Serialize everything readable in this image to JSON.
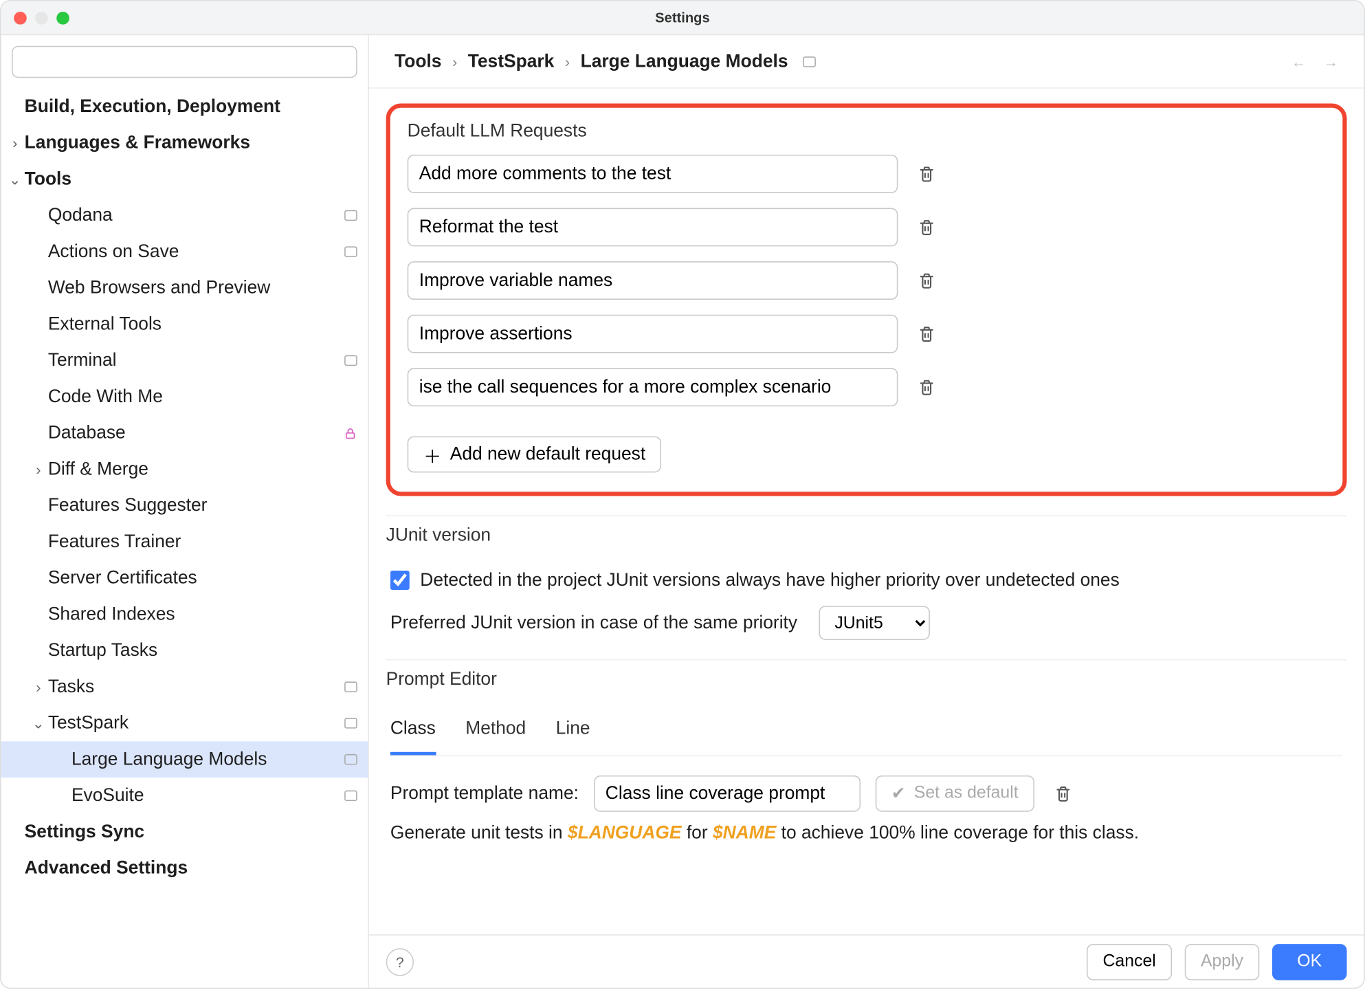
{
  "window": {
    "title": "Settings"
  },
  "search": {
    "placeholder": ""
  },
  "tree": {
    "items": [
      {
        "label": "Build, Execution, Deployment",
        "indent": 1,
        "bold": true,
        "chevron": "none",
        "badge": false,
        "lock": false
      },
      {
        "label": "Languages & Frameworks",
        "indent": 1,
        "bold": true,
        "chevron": "right",
        "badge": false,
        "lock": false
      },
      {
        "label": "Tools",
        "indent": 1,
        "bold": true,
        "chevron": "down",
        "badge": false,
        "lock": false
      },
      {
        "label": "Qodana",
        "indent": 2,
        "bold": false,
        "chevron": "none",
        "badge": true,
        "lock": false
      },
      {
        "label": "Actions on Save",
        "indent": 2,
        "bold": false,
        "chevron": "none",
        "badge": true,
        "lock": false
      },
      {
        "label": "Web Browsers and Preview",
        "indent": 2,
        "bold": false,
        "chevron": "none",
        "badge": false,
        "lock": false
      },
      {
        "label": "External Tools",
        "indent": 2,
        "bold": false,
        "chevron": "none",
        "badge": false,
        "lock": false
      },
      {
        "label": "Terminal",
        "indent": 2,
        "bold": false,
        "chevron": "none",
        "badge": true,
        "lock": false
      },
      {
        "label": "Code With Me",
        "indent": 2,
        "bold": false,
        "chevron": "none",
        "badge": false,
        "lock": false
      },
      {
        "label": "Database",
        "indent": 2,
        "bold": false,
        "chevron": "none",
        "badge": false,
        "lock": true
      },
      {
        "label": "Diff & Merge",
        "indent": 2,
        "bold": false,
        "chevron": "right",
        "badge": false,
        "lock": false
      },
      {
        "label": "Features Suggester",
        "indent": 2,
        "bold": false,
        "chevron": "none",
        "badge": false,
        "lock": false
      },
      {
        "label": "Features Trainer",
        "indent": 2,
        "bold": false,
        "chevron": "none",
        "badge": false,
        "lock": false
      },
      {
        "label": "Server Certificates",
        "indent": 2,
        "bold": false,
        "chevron": "none",
        "badge": false,
        "lock": false
      },
      {
        "label": "Shared Indexes",
        "indent": 2,
        "bold": false,
        "chevron": "none",
        "badge": false,
        "lock": false
      },
      {
        "label": "Startup Tasks",
        "indent": 2,
        "bold": false,
        "chevron": "none",
        "badge": false,
        "lock": false
      },
      {
        "label": "Tasks",
        "indent": 2,
        "bold": false,
        "chevron": "right",
        "badge": true,
        "lock": false
      },
      {
        "label": "TestSpark",
        "indent": 2,
        "bold": false,
        "chevron": "down",
        "badge": true,
        "lock": false
      },
      {
        "label": "Large Language Models",
        "indent": 3,
        "bold": false,
        "chevron": "none",
        "badge": true,
        "lock": false,
        "selected": true
      },
      {
        "label": "EvoSuite",
        "indent": 3,
        "bold": false,
        "chevron": "none",
        "badge": true,
        "lock": false
      },
      {
        "label": "Settings Sync",
        "indent": 1,
        "bold": true,
        "chevron": "none",
        "badge": false,
        "lock": false
      },
      {
        "label": "Advanced Settings",
        "indent": 1,
        "bold": true,
        "chevron": "none",
        "badge": false,
        "lock": false
      }
    ]
  },
  "breadcrumb": {
    "parts": [
      "Tools",
      "TestSpark",
      "Large Language Models"
    ]
  },
  "defaultRequests": {
    "title": "Default LLM Requests",
    "items": [
      "Add more comments to the test",
      "Reformat the test",
      "Improve variable names",
      "Improve assertions",
      "ise the call sequences for a more complex scenario"
    ],
    "addLabel": "Add new default request"
  },
  "junit": {
    "heading": "JUnit version",
    "checkboxLabel": "Detected in the project JUnit versions always have higher priority over undetected ones",
    "checked": true,
    "preferredLabel": "Preferred JUnit version in case of the same priority",
    "preferredValue": "JUnit5"
  },
  "promptEditor": {
    "heading": "Prompt Editor",
    "tabs": [
      "Class",
      "Method",
      "Line"
    ],
    "activeTab": 0,
    "templateNameLabel": "Prompt template name:",
    "templateNameValue": "Class line coverage prompt",
    "setDefaultLabel": "Set as default",
    "bodyPrefix": "Generate unit tests in ",
    "var1": "$LANGUAGE",
    "mid": " for ",
    "var2": "$NAME",
    "bodySuffix": " to achieve 100% line coverage for this class."
  },
  "buttons": {
    "cancel": "Cancel",
    "apply": "Apply",
    "ok": "OK"
  }
}
